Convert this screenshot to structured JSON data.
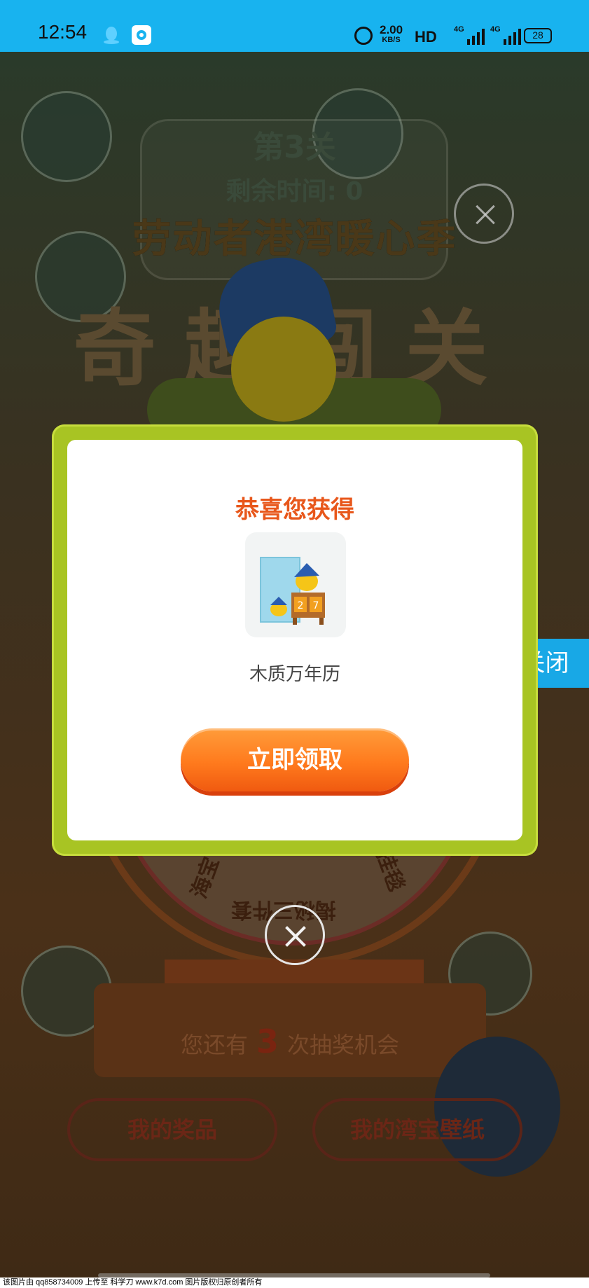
{
  "status_bar": {
    "time": "12:54",
    "net_speed": "2.00",
    "net_speed_unit": "KB/S",
    "hd_label": "HD",
    "sim1": "4G",
    "sim2": "4G",
    "battery": "28"
  },
  "game": {
    "level_title": "第3关",
    "time_label": "剩余时间: 0",
    "event_name": "劳动者港湾暖心季",
    "game_title": "奇趣闯关",
    "wheel_left": "海宝",
    "wheel_bottom": "揭秘三件套",
    "wheel_right": "挂毯",
    "chance_prefix": "您还有",
    "chance_count": "3",
    "chance_suffix": "次抽奖机会",
    "my_prizes": "我的奖品",
    "my_wallpaper": "我的湾宝壁纸"
  },
  "side_close": {
    "label": "关闭"
  },
  "modal": {
    "title": "恭喜您获得",
    "prize_name": "木质万年历",
    "claim_label": "立即领取",
    "calendar_digits": [
      "2",
      "7"
    ]
  },
  "watermark": "该图片由 qq858734009 上传至 科学刀 www.k7d.com 图片版权归原创者所有",
  "colors": {
    "status_bar": "#18b3ef",
    "modal_border": "#a8c423",
    "accent_orange": "#ff7a1d",
    "title_orange": "#e8571b",
    "side_tab": "#18a8e6"
  }
}
